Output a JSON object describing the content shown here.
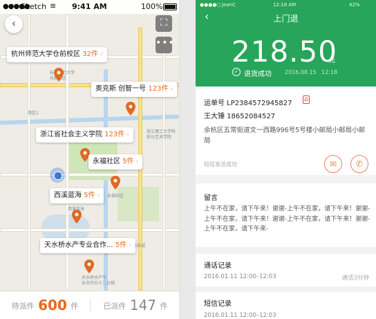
{
  "left": {
    "status": {
      "carrier": "Sketch",
      "time": "9:41 AM",
      "battery": "100%"
    },
    "callouts": [
      {
        "name": "杭州师范大学仓前校区",
        "count": "32件"
      },
      {
        "name": "奥克斯 创智一号",
        "count": "123件"
      },
      {
        "name": "浙江省社会主义学院",
        "count": "123件"
      },
      {
        "name": "永福社区",
        "count": "5件"
      },
      {
        "name": "西溪蓝海",
        "count": "5件"
      },
      {
        "name": "天水桥水产专业合作...",
        "count": "5件"
      }
    ],
    "map_labels": [
      "杭州师范大学",
      "仓前校区",
      "南区1",
      "浙江理工大学科",
      "技与艺术学院",
      "永福社区",
      "天水桥水产专",
      "业合作社十二分销",
      "未来科技城",
      "西溪蓝海"
    ],
    "bottom": {
      "pending_label": "待派件",
      "pending_count": "600",
      "pending_unit": "件",
      "sent_label": "已派件",
      "sent_count": "147",
      "sent_unit": "件"
    }
  },
  "right": {
    "status": {
      "carrier": "JeanC",
      "time": "12:18 AM",
      "battery": "42%"
    },
    "title": "上门退",
    "amount": "218.50",
    "unit": "元",
    "refund_status": "退货成功",
    "refund_date": "2016.08.15",
    "refund_time": "12:18",
    "waybill": "运单号  LP2384572945827",
    "name_phone": "王大锤  18652084527",
    "address": "余杭区五常街道文一西路996号5号楼小邮局小邮局小邮局",
    "sms_sent": "短信发送成功",
    "message_title": "留言",
    "message_body": "上午不在家，请下午来！谢谢-上午不在家，请下午来！谢谢-上午不在家，请下午来！谢谢-上午不在家，请下午来！谢谢-上午不在家，请下午来-",
    "call_title": "通话记录",
    "call_time": "2016.01.11   12:00–12:03",
    "call_duration": "通话3分钟",
    "sms_title": "短信记录",
    "sms_time": "2016.01.11   12:00–12:03"
  },
  "colors": {
    "brand_green": "#27a55a",
    "accent_orange": "#e86a1b"
  }
}
